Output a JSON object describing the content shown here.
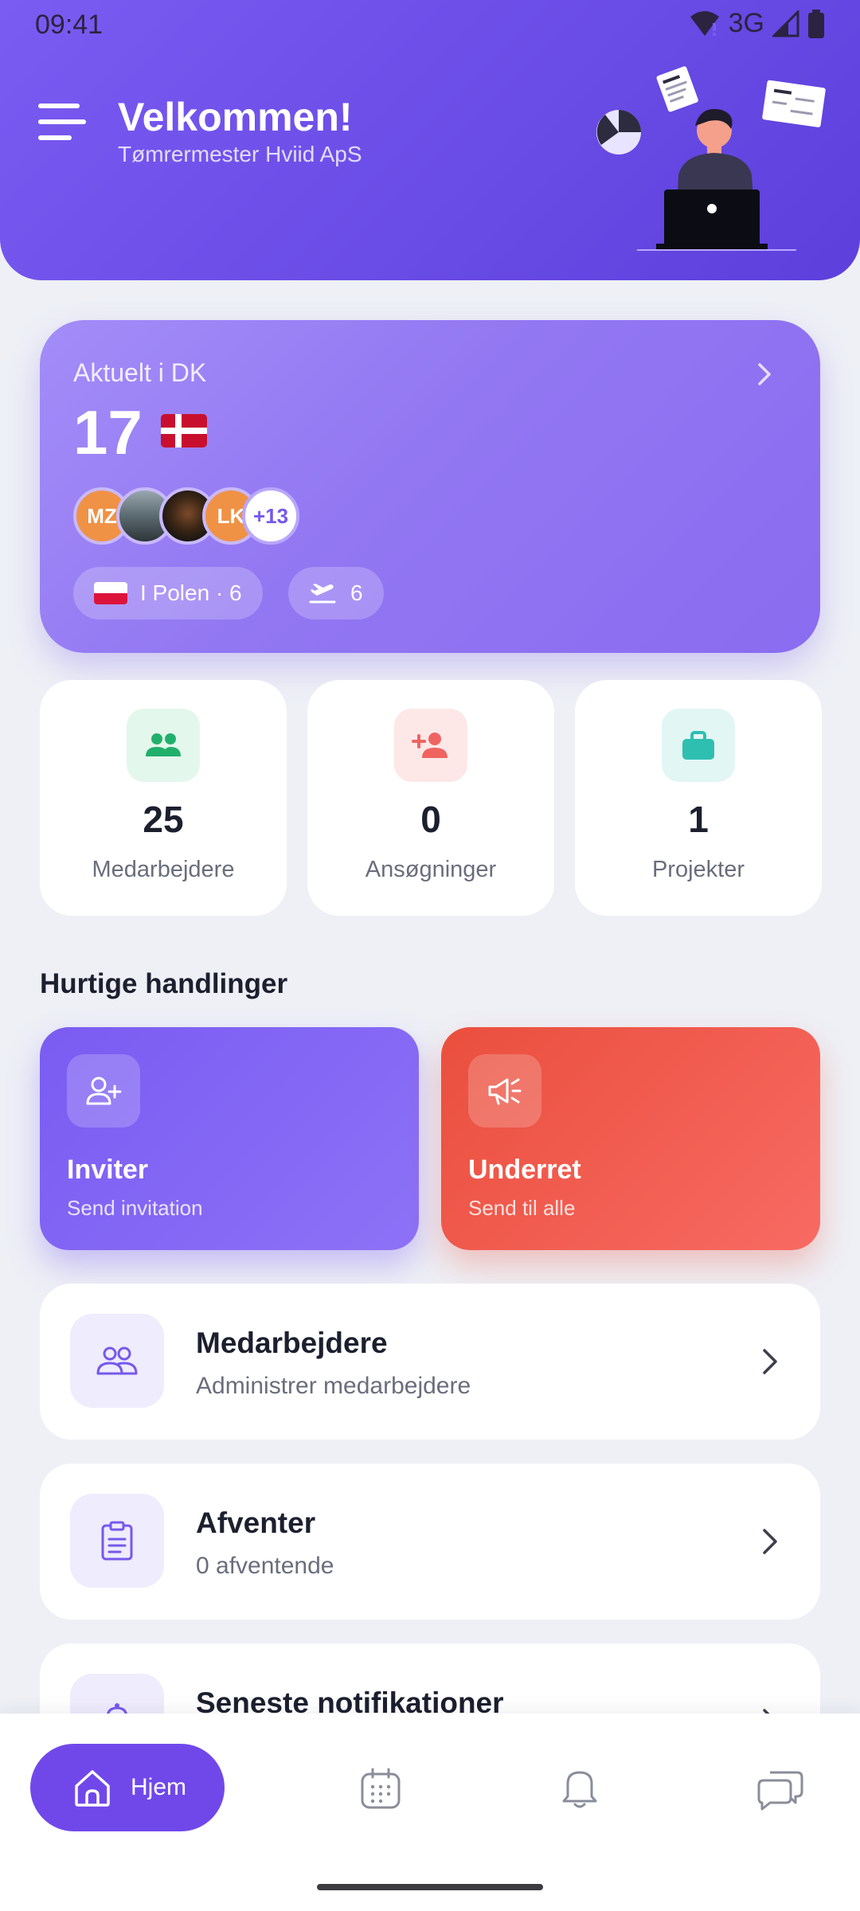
{
  "status_bar": {
    "time": "09:41",
    "network": "3G",
    "icons": [
      "wifi-icon",
      "signal-icon",
      "battery-icon"
    ]
  },
  "header": {
    "welcome": "Velkommen!",
    "company": "Tømrermester Hviid ApS"
  },
  "hero": {
    "title": "Aktuelt i DK",
    "count": "17",
    "avatars": [
      {
        "initials": "MZ",
        "type": "initials"
      },
      {
        "initials": "",
        "type": "photo"
      },
      {
        "initials": "",
        "type": "photo"
      },
      {
        "initials": "LK",
        "type": "initials"
      }
    ],
    "more_count": "+13",
    "chips": {
      "poland": "I Polen · 6",
      "travel": "6"
    }
  },
  "stats": [
    {
      "value": "25",
      "label": "Medarbejdere",
      "icon": "people-icon",
      "color": "#21b06b",
      "bg": "#e4f7ec"
    },
    {
      "value": "0",
      "label": "Ansøgninger",
      "icon": "person-add-icon",
      "color": "#ef6461",
      "bg": "#fde8e7"
    },
    {
      "value": "1",
      "label": "Projekter",
      "icon": "briefcase-icon",
      "color": "#2ebfb0",
      "bg": "#e2f6f4"
    }
  ],
  "quick_actions": {
    "title": "Hurtige handlinger",
    "invite": {
      "title": "Inviter",
      "subtitle": "Send invitation"
    },
    "notify": {
      "title": "Underret",
      "subtitle": "Send til alle"
    }
  },
  "rows": [
    {
      "title": "Medarbejdere",
      "subtitle": "Administrer medarbejdere",
      "icon": "people-outline-icon"
    },
    {
      "title": "Afventer",
      "subtitle": "0 afventende",
      "icon": "clipboard-icon"
    },
    {
      "title": "Seneste notifikationer",
      "subtitle": "",
      "icon": "bell-icon"
    }
  ],
  "bottom_nav": {
    "home": "Hjem",
    "items": [
      "home-icon",
      "calendar-icon",
      "bell-icon",
      "chat-icon"
    ]
  },
  "colors": {
    "primary": "#7048ea",
    "accent_red": "#ea4f3d",
    "background": "#eef0f6"
  }
}
